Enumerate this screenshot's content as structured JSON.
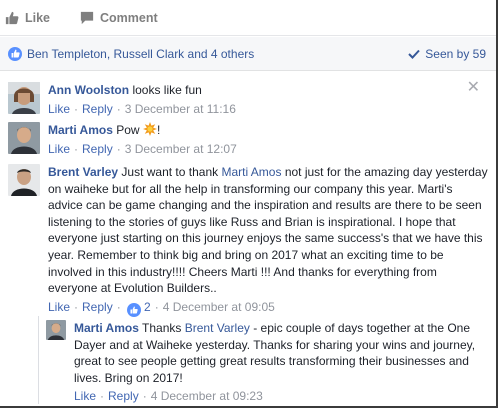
{
  "actions": {
    "like_label": "Like",
    "comment_label": "Comment"
  },
  "reactions": {
    "names": "Ben Templeton, Russell Clark and 4 others",
    "seen_by": "Seen by 59"
  },
  "comments": [
    {
      "author": "Ann Woolston",
      "text": "looks like fun",
      "like": "Like",
      "reply": "Reply",
      "time": "3 December at 11:16"
    },
    {
      "author": "Marti Amos",
      "text": "Pow",
      "text_end": "!",
      "like": "Like",
      "reply": "Reply",
      "time": "3 December at 12:07"
    },
    {
      "author": "Brent Varley",
      "text_pre": "Just want to thank",
      "mention": "Marti Amos",
      "text_post": "not just for the amazing day yesterday on waiheke but for all the help in transforming our company this year. Marti's advice can be game changing and the inspiration and results are there to be seen listening to the stories of guys like Russ and Brian is inspirational. I hope that everyone just starting on this journey enjoys the same success's that we have this year. Remember to think big and bring on 2017 what an exciting time to be involved in this industry!!!! Cheers Marti !!! And thanks for everything from everyone at Evolution Builders..",
      "like": "Like",
      "reply": "Reply",
      "like_count": "2",
      "time": "4 December at 09:05"
    }
  ],
  "reply": {
    "author": "Marti Amos",
    "text_pre": "Thanks",
    "mention": "Brent Varley",
    "text_post": "- epic couple of days together at the One Dayer and at Waiheke yesterday. Thanks for sharing your wins and journey, great to see people getting great results transforming their businesses and lives. Bring on 2017!",
    "like": "Like",
    "reply": "Reply",
    "time": "4 December at 09:23"
  },
  "colors": {
    "link": "#365899",
    "meta": "#90949c",
    "like_bubble": "#5890ff",
    "border_frame": "#3b3b3b"
  }
}
